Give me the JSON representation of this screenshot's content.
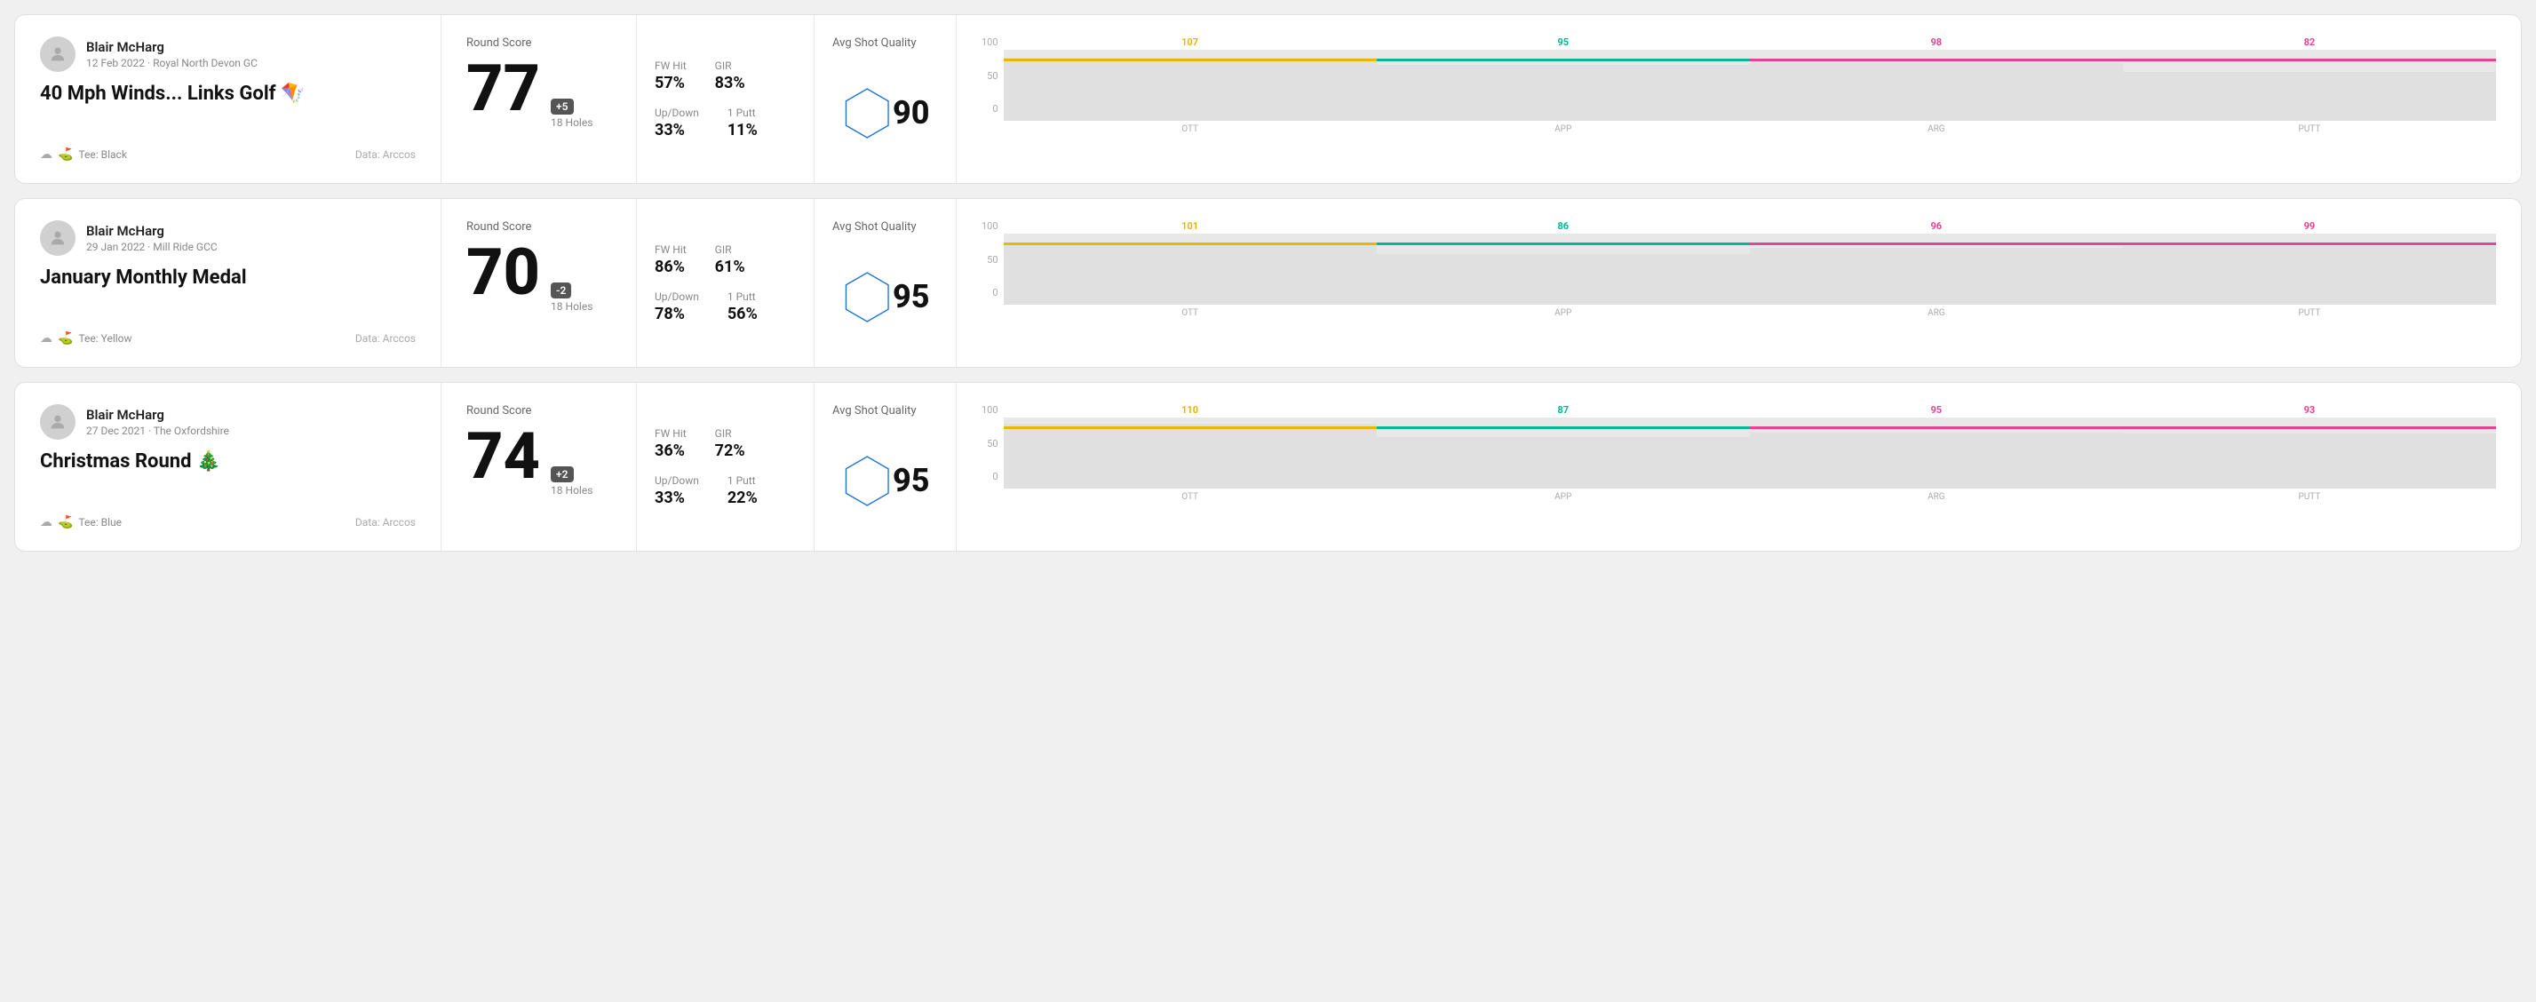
{
  "rounds": [
    {
      "id": "round-1",
      "player": {
        "name": "Blair McHarg",
        "date": "12 Feb 2022 · Royal North Devon GC",
        "avatar": "person"
      },
      "title": "40 Mph Winds... Links Golf 🪁",
      "tee": "Black",
      "data_source": "Data: Arccos",
      "score": {
        "value": "77",
        "badge": "+5",
        "badge_type": "positive",
        "holes": "18 Holes"
      },
      "stats": {
        "fw_hit_label": "FW Hit",
        "fw_hit_value": "57%",
        "gir_label": "GIR",
        "gir_value": "83%",
        "updown_label": "Up/Down",
        "updown_value": "33%",
        "oneputt_label": "1 Putt",
        "oneputt_value": "11%"
      },
      "quality": {
        "label": "Avg Shot Quality",
        "value": "90"
      },
      "chart": {
        "bars": [
          {
            "label": "OTT",
            "value": 107,
            "color": "#e6b800",
            "max": 120
          },
          {
            "label": "APP",
            "value": 95,
            "color": "#00b894",
            "max": 120
          },
          {
            "label": "ARG",
            "value": 98,
            "color": "#e84393",
            "max": 120
          },
          {
            "label": "PUTT",
            "value": 82,
            "color": "#e84393",
            "max": 120
          }
        ],
        "y_labels": [
          "100",
          "50",
          "0"
        ]
      }
    },
    {
      "id": "round-2",
      "player": {
        "name": "Blair McHarg",
        "date": "29 Jan 2022 · Mill Ride GCC",
        "avatar": "person"
      },
      "title": "January Monthly Medal",
      "tee": "Yellow",
      "data_source": "Data: Arccos",
      "score": {
        "value": "70",
        "badge": "-2",
        "badge_type": "negative",
        "holes": "18 Holes"
      },
      "stats": {
        "fw_hit_label": "FW Hit",
        "fw_hit_value": "86%",
        "gir_label": "GIR",
        "gir_value": "61%",
        "updown_label": "Up/Down",
        "updown_value": "78%",
        "oneputt_label": "1 Putt",
        "oneputt_value": "56%"
      },
      "quality": {
        "label": "Avg Shot Quality",
        "value": "95"
      },
      "chart": {
        "bars": [
          {
            "label": "OTT",
            "value": 101,
            "color": "#e6b800",
            "max": 120
          },
          {
            "label": "APP",
            "value": 86,
            "color": "#00b894",
            "max": 120
          },
          {
            "label": "ARG",
            "value": 96,
            "color": "#e84393",
            "max": 120
          },
          {
            "label": "PUTT",
            "value": 99,
            "color": "#e84393",
            "max": 120
          }
        ],
        "y_labels": [
          "100",
          "50",
          "0"
        ]
      }
    },
    {
      "id": "round-3",
      "player": {
        "name": "Blair McHarg",
        "date": "27 Dec 2021 · The Oxfordshire",
        "avatar": "person"
      },
      "title": "Christmas Round 🎄",
      "tee": "Blue",
      "data_source": "Data: Arccos",
      "score": {
        "value": "74",
        "badge": "+2",
        "badge_type": "positive",
        "holes": "18 Holes"
      },
      "stats": {
        "fw_hit_label": "FW Hit",
        "fw_hit_value": "36%",
        "gir_label": "GIR",
        "gir_value": "72%",
        "updown_label": "Up/Down",
        "updown_value": "33%",
        "oneputt_label": "1 Putt",
        "oneputt_value": "22%"
      },
      "quality": {
        "label": "Avg Shot Quality",
        "value": "95"
      },
      "chart": {
        "bars": [
          {
            "label": "OTT",
            "value": 110,
            "color": "#e6b800",
            "max": 120
          },
          {
            "label": "APP",
            "value": 87,
            "color": "#00b894",
            "max": 120
          },
          {
            "label": "ARG",
            "value": 95,
            "color": "#e84393",
            "max": 120
          },
          {
            "label": "PUTT",
            "value": 93,
            "color": "#e84393",
            "max": 120
          }
        ],
        "y_labels": [
          "100",
          "50",
          "0"
        ]
      }
    }
  ]
}
